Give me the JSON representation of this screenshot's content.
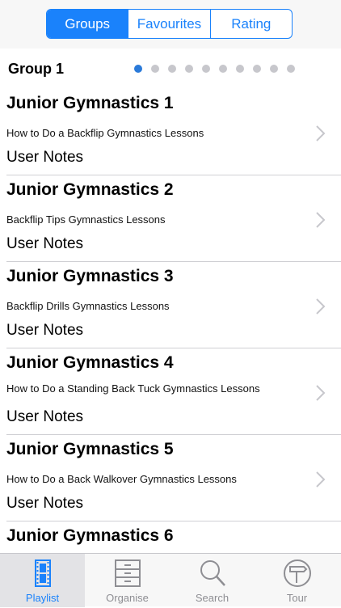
{
  "segments": [
    {
      "label": "Groups",
      "active": true
    },
    {
      "label": "Favourites",
      "active": false
    },
    {
      "label": "Rating",
      "active": false
    }
  ],
  "group": {
    "title": "Group 1",
    "page_count": 10,
    "current_page": 1
  },
  "items": [
    {
      "title": "Junior Gymnastics 1",
      "subtitle": "How to Do a Backflip  Gymnastics Lessons",
      "notes": "User Notes"
    },
    {
      "title": "Junior Gymnastics 2",
      "subtitle": "Backflip Tips  Gymnastics Lessons",
      "notes": "User Notes"
    },
    {
      "title": "Junior Gymnastics 3",
      "subtitle": "Backflip Drills  Gymnastics Lessons",
      "notes": "User Notes"
    },
    {
      "title": "Junior Gymnastics 4",
      "subtitle": "How to Do a Standing Back Tuck  Gymnastics Lessons",
      "notes": "User Notes"
    },
    {
      "title": "Junior Gymnastics 5",
      "subtitle": "How to Do a Back Walkover  Gymnastics Lessons",
      "notes": "User Notes"
    },
    {
      "title": "Junior Gymnastics 6",
      "subtitle": "",
      "notes": ""
    }
  ],
  "tabs": [
    {
      "label": "Playlist",
      "icon": "film-icon",
      "active": true
    },
    {
      "label": "Organise",
      "icon": "cabinet-icon",
      "active": false
    },
    {
      "label": "Search",
      "icon": "search-icon",
      "active": false
    },
    {
      "label": "Tour",
      "icon": "signpost-icon",
      "active": false
    }
  ],
  "colors": {
    "accent": "#1a82fb",
    "inactive": "#8e8e93",
    "dot_inactive": "#c7c7cc",
    "dot_active": "#2a7ad9"
  }
}
